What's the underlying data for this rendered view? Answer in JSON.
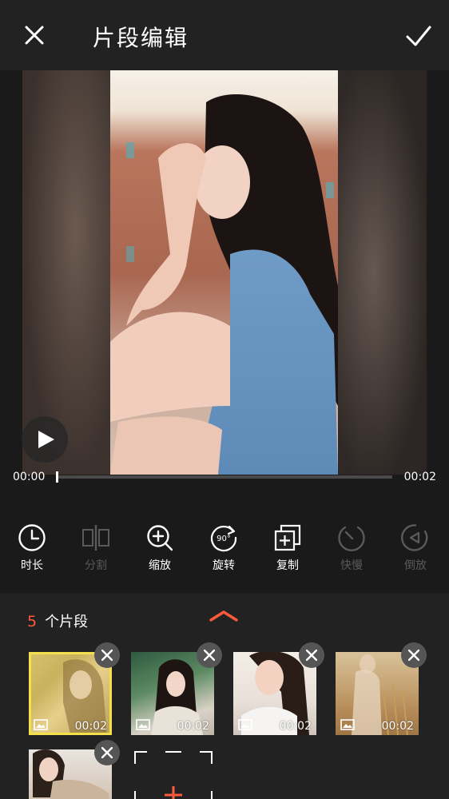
{
  "header": {
    "title": "片段编辑",
    "close_icon": "close-icon",
    "confirm_icon": "checkmark-icon"
  },
  "player": {
    "current_time": "00:00",
    "total_time": "00:02",
    "progress": 0.0,
    "play_icon": "play-icon"
  },
  "toolbar": {
    "tools": [
      {
        "label": "时长",
        "icon": "clock-icon",
        "enabled": true
      },
      {
        "label": "分割",
        "icon": "split-icon",
        "enabled": false
      },
      {
        "label": "缩放",
        "icon": "zoom-in-icon",
        "enabled": true
      },
      {
        "label": "旋转",
        "icon": "rotate-90-icon",
        "enabled": true
      },
      {
        "label": "复制",
        "icon": "duplicate-icon",
        "enabled": true
      },
      {
        "label": "快慢",
        "icon": "speed-icon",
        "enabled": false
      },
      {
        "label": "倒放",
        "icon": "reverse-icon",
        "enabled": false
      }
    ],
    "rotate_badge": "90°"
  },
  "clips_panel": {
    "count": "5",
    "count_label": "个片段",
    "accent_color": "#ff5a3c",
    "clips": [
      {
        "duration": "00:02",
        "selected": true
      },
      {
        "duration": "00:02",
        "selected": false
      },
      {
        "duration": "00:02",
        "selected": false
      },
      {
        "duration": "00:02",
        "selected": false
      },
      {
        "duration": "",
        "selected": false
      }
    ],
    "add_icon": "plus-icon"
  }
}
